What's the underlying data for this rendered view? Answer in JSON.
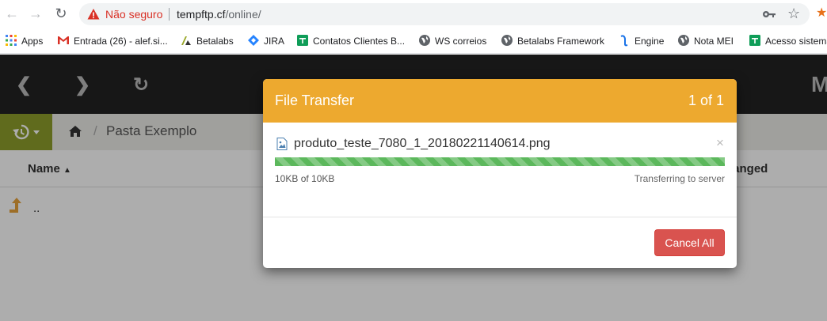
{
  "browser": {
    "security_label": "Não seguro",
    "url_host": "tempftp.cf",
    "url_path": "/online/",
    "bookmarks": [
      {
        "label": "Apps",
        "icon": "apps-grid-icon"
      },
      {
        "label": "Entrada (26) - alef.si...",
        "icon": "gmail-icon"
      },
      {
        "label": "Betalabs",
        "icon": "betalabs-icon"
      },
      {
        "label": "JIRA",
        "icon": "jira-icon"
      },
      {
        "label": "Contatos Clientes B...",
        "icon": "sheets-icon"
      },
      {
        "label": "WS correios",
        "icon": "globe-icon"
      },
      {
        "label": "Betalabs Framework",
        "icon": "globe-icon"
      },
      {
        "label": "Engine",
        "icon": "engine-icon"
      },
      {
        "label": "Nota MEI",
        "icon": "globe-icon"
      },
      {
        "label": "Acesso sistema",
        "icon": "sheets-icon"
      }
    ],
    "colors": {
      "warning": "#d93025",
      "omnibox": "#f1f3f4"
    }
  },
  "app": {
    "breadcrumb": {
      "folder": "Pasta Exemplo"
    },
    "table": {
      "col_name": "Name",
      "col_changed": "hanged",
      "rows": [
        {
          "name": ".."
        }
      ]
    },
    "colors": {
      "topbar": "#222222",
      "history": "#8e9e2b",
      "breadcrumb_bg": "#ecece8"
    }
  },
  "modal": {
    "title": "File Transfer",
    "count": "1 of 1",
    "file_name": "produto_teste_7080_1_20180221140614.png",
    "transferred": "10KB of 10KB",
    "status": "Transferring to server",
    "progress_fraction": 1.0,
    "cancel_label": "Cancel All",
    "colors": {
      "header": "#eda92f",
      "progress": "#5cb85c",
      "cancel": "#d9534f"
    }
  }
}
